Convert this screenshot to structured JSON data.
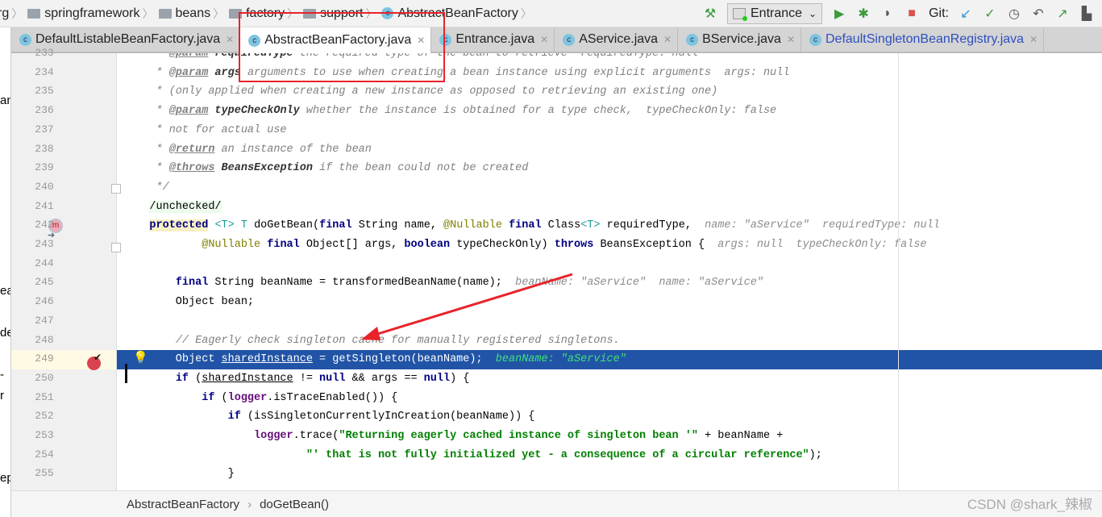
{
  "breadcrumb": [
    {
      "label": "rg",
      "icon": "none"
    },
    {
      "label": "springframework",
      "icon": "folder-icon"
    },
    {
      "label": "beans",
      "icon": "folder-icon"
    },
    {
      "label": "factory",
      "icon": "folder-icon"
    },
    {
      "label": "support",
      "icon": "folder-icon"
    },
    {
      "label": "AbstractBeanFactory",
      "icon": "class-icon"
    }
  ],
  "toolbar": {
    "run_config": "Entrance",
    "git_label": "Git:"
  },
  "tabs": [
    {
      "label": "DefaultListableBeanFactory.java",
      "active": false
    },
    {
      "label": "AbstractBeanFactory.java",
      "active": true
    },
    {
      "label": "Entrance.java",
      "active": false
    },
    {
      "label": "AService.java",
      "active": false
    },
    {
      "label": "BService.java",
      "active": false
    },
    {
      "label": "DefaultSingletonBeanRegistry.java",
      "active": false,
      "color": "#2d4fbf"
    }
  ],
  "left_strip": [
    "an",
    "ea",
    "de",
    "-",
    "r",
    "ep"
  ],
  "gutter": {
    "first_line": 233,
    "last_line": 255,
    "current_line": 249
  },
  "code_lines": [
    [
      [
        "     * ",
        "cm"
      ],
      [
        "@param",
        "tag"
      ],
      [
        " requiredType",
        "tagname"
      ],
      [
        " the required type of the bean to retrieve  requiredType: null",
        "cm"
      ]
    ],
    [
      [
        "     * ",
        "cm"
      ],
      [
        "@param",
        "tag"
      ],
      [
        " args",
        "tagname"
      ],
      [
        " arguments to use when creating a bean instance using explicit arguments  args: null",
        "cm"
      ]
    ],
    [
      [
        "     * (only applied when creating a new instance as opposed to retrieving an existing one)",
        "cm"
      ]
    ],
    [
      [
        "     * ",
        "cm"
      ],
      [
        "@param",
        "tag"
      ],
      [
        " typeCheckOnly",
        "tagname"
      ],
      [
        " whether the instance is obtained for a type check,  typeCheckOnly: false",
        "cm"
      ]
    ],
    [
      [
        "     * not for actual use",
        "cm"
      ]
    ],
    [
      [
        "     * ",
        "cm"
      ],
      [
        "@return",
        "tag"
      ],
      [
        " an instance of the bean",
        "cm"
      ]
    ],
    [
      [
        "     * ",
        "cm"
      ],
      [
        "@throws",
        "tag"
      ],
      [
        " BeansException",
        "tagname"
      ],
      [
        " if the bean could not be created",
        "cm"
      ]
    ],
    [
      [
        "     */",
        "cm"
      ]
    ],
    [
      [
        "    ",
        ""
      ],
      [
        "/unchecked/",
        "unchk"
      ]
    ],
    [
      [
        "    ",
        ""
      ],
      [
        "protected",
        "kw prot"
      ],
      [
        " ",
        ""
      ],
      [
        "<T>",
        "gen"
      ],
      [
        " ",
        ""
      ],
      [
        "T",
        "gen"
      ],
      [
        " doGetBean(",
        ""
      ],
      [
        "final",
        "kw"
      ],
      [
        " String name, ",
        ""
      ],
      [
        "@Nullable",
        "ann"
      ],
      [
        " ",
        ""
      ],
      [
        "final",
        "kw"
      ],
      [
        " Class",
        ""
      ],
      [
        "<T>",
        "gen"
      ],
      [
        " requiredType,  ",
        ""
      ],
      [
        "name: \"aService\"  requiredType: null",
        "hint"
      ]
    ],
    [
      [
        "            ",
        ""
      ],
      [
        "@Nullable",
        "ann"
      ],
      [
        " ",
        ""
      ],
      [
        "final",
        "kw"
      ],
      [
        " Object[] args, ",
        ""
      ],
      [
        "boolean",
        "kw"
      ],
      [
        " typeCheckOnly) ",
        ""
      ],
      [
        "throws",
        "kw"
      ],
      [
        " BeansException {  ",
        ""
      ],
      [
        "args: null  typeCheckOnly: false",
        "hint"
      ]
    ],
    [
      [
        "",
        ""
      ]
    ],
    [
      [
        "        ",
        ""
      ],
      [
        "final",
        "kw"
      ],
      [
        " String beanName = transformedBeanName(name);  ",
        ""
      ],
      [
        "beanName: \"aService\"  name: \"aService\"",
        "hint"
      ]
    ],
    [
      [
        "        Object bean;",
        ""
      ]
    ],
    [
      [
        "",
        ""
      ]
    ],
    [
      [
        "        ",
        ""
      ],
      [
        "// Eagerly check singleton cache for manually registered singletons.",
        "cm"
      ]
    ],
    [
      [
        "        Object ",
        ""
      ],
      [
        "sharedInstance",
        "ul"
      ],
      [
        " = getSingleton(beanName);  ",
        ""
      ],
      [
        "beanName: \"aService\"",
        "hintg"
      ]
    ],
    [
      [
        "        ",
        ""
      ],
      [
        "if",
        "kw"
      ],
      [
        " (",
        ""
      ],
      [
        "sharedInstance",
        "ul"
      ],
      [
        " != ",
        ""
      ],
      [
        "null",
        "kw"
      ],
      [
        " && args == ",
        ""
      ],
      [
        "null",
        "kw"
      ],
      [
        ") {",
        ""
      ]
    ],
    [
      [
        "            ",
        ""
      ],
      [
        "if",
        "kw"
      ],
      [
        " (",
        ""
      ],
      [
        "logger",
        "fld"
      ],
      [
        ".isTraceEnabled()) {",
        ""
      ]
    ],
    [
      [
        "                ",
        ""
      ],
      [
        "if",
        "kw"
      ],
      [
        " (isSingletonCurrentlyInCreation(beanName)) {",
        ""
      ]
    ],
    [
      [
        "                    ",
        ""
      ],
      [
        "logger",
        "fld"
      ],
      [
        ".trace(",
        ""
      ],
      [
        "\"Returning eagerly cached instance of singleton bean '\"",
        "str"
      ],
      [
        " + beanName +",
        ""
      ]
    ],
    [
      [
        "                            ",
        ""
      ],
      [
        "\"' that is not fully initialized yet - a consequence of a circular reference\"",
        "str"
      ],
      [
        ");",
        ""
      ]
    ],
    [
      [
        "                }",
        ""
      ]
    ]
  ],
  "status_breadcrumb": [
    "AbstractBeanFactory",
    "doGetBean()"
  ],
  "watermark": "CSDN @shark_辣椒",
  "colors": {
    "selection": "#2154a6",
    "annotation_red": "#e8232a"
  }
}
